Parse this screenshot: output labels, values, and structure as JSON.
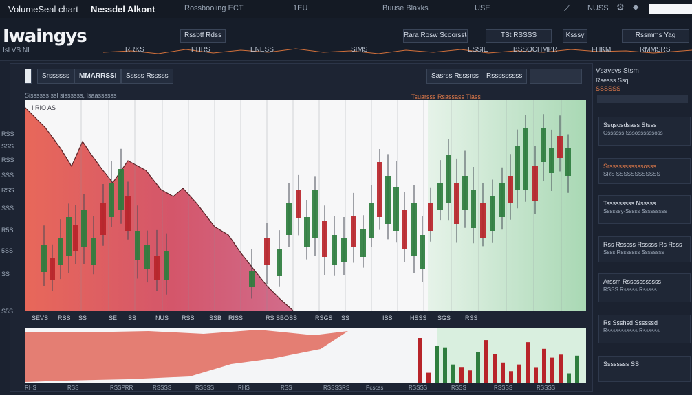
{
  "topbar": {
    "title": "VolumeSeal chart",
    "app": "Nessdel Alkont",
    "items": [
      "Rossbooling ECT",
      "1EU",
      "Buuse Blaxks",
      "USE",
      "NUSS"
    ]
  },
  "brand": {
    "logo": "Iwaingys",
    "sub": "Isl VS NL",
    "nav": [
      "Rssbtf Rdss",
      "Rara Rosw Scoorsstas",
      "TSt RSSSS",
      "Ksssy",
      "Rssmms Yag"
    ]
  },
  "ticker": [
    "RRKS",
    "PHRS",
    "ENESS",
    "SIMS",
    "ESSIE",
    "BSSOCHMPR",
    "FHKM",
    "RMMSRS"
  ],
  "chart_tabs": [
    "Srssssss",
    "MMARRSSI",
    "Sssss Rsssss",
    "Sasrss Rsssrss",
    "Rsssssssss"
  ],
  "chart_subheader": "Sissssss ssl sissssss, Isaassssss",
  "chart_orange": "Tsuarsss Rsassass Tlass",
  "price_label": "I RIO AS",
  "y_labels": [
    "RSS",
    "SSS",
    "RSS",
    "SSS",
    "RSS",
    "SSS",
    "R5S",
    "5SS",
    "SS",
    "S5S"
  ],
  "x_labels": [
    "SEVS",
    "RSS",
    "SS",
    "SE",
    "SS",
    "NUS",
    "RSS",
    "SSB",
    "RISS",
    "RS SBO",
    "SS",
    "RSGS",
    "SS",
    "ISS",
    "HSSS",
    "SGS",
    "RSS"
  ],
  "bottom_labels": [
    "RHS",
    "RSS",
    "RSSPRR",
    "RSSSS",
    "RSSSS",
    "RHS",
    "RSS",
    "RSSSSRS",
    "Pcscss",
    "RSSSS",
    "RSSS",
    "RSSSS",
    "RSSSS"
  ],
  "side": {
    "title": "Vsaysvs Stsm",
    "line1": "Rsesss Ssq",
    "line2": "SSSSSS",
    "cards": [
      {
        "t1": "Ssqsosdsass Stsss",
        "t2": "Ossssss Sssossssssoss"
      },
      {
        "t1": "Srsssssssssssosss",
        "t2": "SRS SSSSSSSSSSSS"
      },
      {
        "t1": "Tsssssssss Nsssss",
        "t2": "Ssssssy-Sssss Sssssssss"
      },
      {
        "t1": "Rss Rsssss Rsssss Rs Rsss",
        "t2": "Ssss Rsssssss Ssssssss"
      },
      {
        "t1": "Arssm Rsssssssssss",
        "t2": "RSSS Rsssss Rsssss"
      },
      {
        "t1": "Rs Ssshsd Ssssssd",
        "t2": "Rsssssssssss Rssssss"
      },
      {
        "t1": "Ssssssss SS",
        "t2": ""
      }
    ]
  },
  "colors": {
    "bg": "#1b2230",
    "up": "#2e7d3e",
    "down": "#b8242a",
    "area_red": "#e06a5a",
    "area_green": "#bfe3c8"
  }
}
